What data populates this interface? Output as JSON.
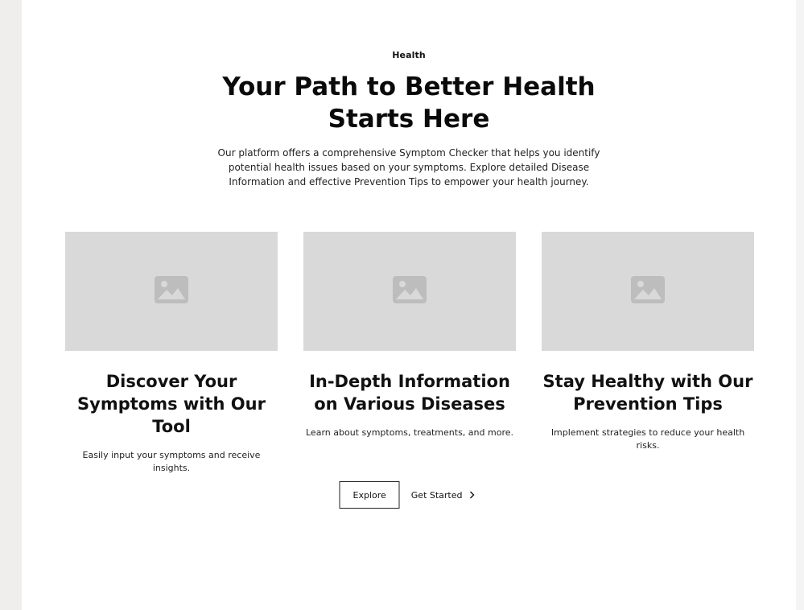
{
  "header": {
    "tagline": "Health",
    "title": "Your Path to Better Health Starts Here",
    "description": "Our platform offers a comprehensive Symptom Checker that helps you identify potential health issues based on your symptoms. Explore detailed Disease Information and effective Prevention Tips to empower your health journey."
  },
  "cards": [
    {
      "title": "Discover Your Symptoms with Our Tool",
      "description": "Easily input your symptoms and receive insights.",
      "icon": "image-placeholder-icon"
    },
    {
      "title": "In-Depth Information on Various Diseases",
      "description": "Learn about symptoms, treatments, and more.",
      "icon": "image-placeholder-icon"
    },
    {
      "title": "Stay Healthy with Our Prevention Tips",
      "description": "Implement strategies to reduce your health risks.",
      "icon": "image-placeholder-icon"
    }
  ],
  "actions": {
    "explore_label": "Explore",
    "get_started_label": "Get Started",
    "get_started_icon": "chevron-right-icon"
  },
  "colors": {
    "page_background": "#efeeec",
    "content_background": "#ffffff",
    "placeholder": "#d9d9d9",
    "placeholder_icon": "#bdbdbd",
    "text": "#111111"
  }
}
